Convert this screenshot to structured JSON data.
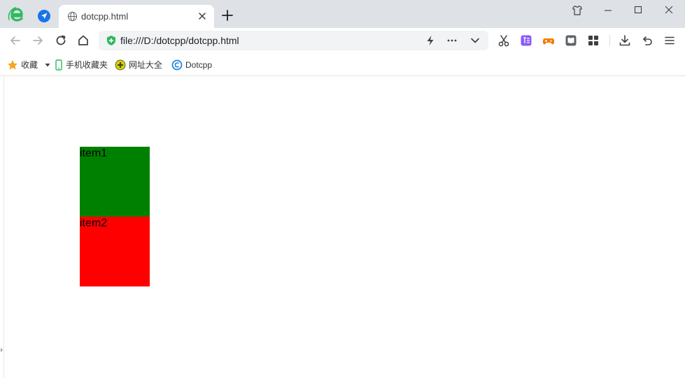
{
  "browser": {
    "tab": {
      "title": "dotcpp.html"
    },
    "address_bar": {
      "url": "file:///D:/dotcpp/dotcpp.html"
    },
    "bookmarks": [
      {
        "label": "收藏",
        "icon": "star-icon"
      },
      {
        "label": "手机收藏夹",
        "icon": "phone-icon"
      },
      {
        "label": "网址大全",
        "icon": "plus-globe-icon"
      },
      {
        "label": "Dotcpp",
        "icon": "dotcpp-icon"
      }
    ],
    "colors": {
      "tabstrip": "#dee1e6",
      "omnibox": "#f1f3f4",
      "logo": "#2dba5e"
    }
  },
  "page": {
    "items": [
      {
        "label": "item1",
        "color": "#008000"
      },
      {
        "label": "item2",
        "color": "#ff0000"
      }
    ]
  }
}
